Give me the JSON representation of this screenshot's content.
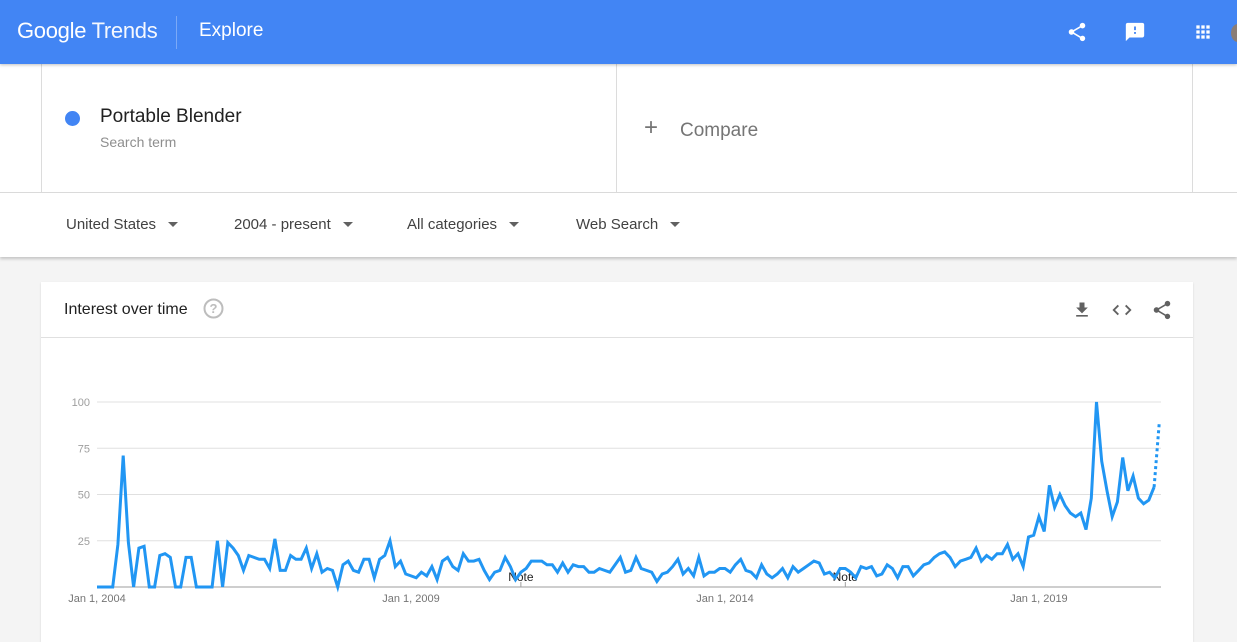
{
  "header": {
    "logo_google": "Google",
    "logo_trends": "Trends",
    "page_title": "Explore",
    "icons": [
      "share-icon",
      "feedback-icon",
      "apps-grid-icon"
    ],
    "accent_color": "#4285f4"
  },
  "search": {
    "term": "Portable Blender",
    "term_subtitle": "Search term",
    "term_color": "#4285f4",
    "compare_label": "Compare",
    "compare_icon": "plus-icon"
  },
  "filters": {
    "region": "United States",
    "time_range": "2004 - present",
    "category": "All categories",
    "property": "Web Search"
  },
  "card": {
    "title": "Interest over time",
    "help_icon": "help-circle-icon",
    "actions": [
      "download-icon",
      "embed-code-icon",
      "share-icon"
    ]
  },
  "chart_data": {
    "type": "line",
    "title": "Interest over time",
    "xlabel": "",
    "ylabel": "",
    "ylim": [
      0,
      100
    ],
    "y_ticks": [
      "25",
      "50",
      "75",
      "100"
    ],
    "y_tick_values": [
      25,
      50,
      75,
      100
    ],
    "x_tick_labels": [
      "Jan 1, 2004",
      "Jan 1, 2009",
      "Jan 1, 2014",
      "Jan 1, 2019"
    ],
    "x_tick_month_index": [
      0,
      60,
      120,
      180
    ],
    "grid": true,
    "legend": "none",
    "line_color": "#2196f3",
    "start": "2004-01",
    "interval": "month",
    "annotations": [
      {
        "label": "Note",
        "month_index": 81
      },
      {
        "label": "Note",
        "month_index": 143
      }
    ],
    "partial_last_point": true,
    "series": [
      {
        "name": "Portable Blender",
        "values": [
          0,
          0,
          0,
          0,
          23,
          71,
          24,
          0,
          21,
          22,
          0,
          0,
          17,
          18,
          16,
          0,
          0,
          16,
          16,
          0,
          0,
          0,
          0,
          25,
          0,
          24,
          21,
          17,
          9,
          17,
          16,
          15,
          15,
          10,
          26,
          9,
          9,
          17,
          15,
          15,
          21,
          10,
          18,
          8,
          10,
          9,
          0,
          12,
          14,
          9,
          8,
          15,
          15,
          5,
          15,
          17,
          25,
          11,
          14,
          7,
          6,
          5,
          8,
          6,
          11,
          4,
          14,
          16,
          11,
          9,
          18,
          14,
          14,
          15,
          9,
          4,
          8,
          9,
          16,
          11,
          4,
          8,
          10,
          14,
          14,
          14,
          12,
          12,
          8,
          13,
          8,
          12,
          11,
          11,
          8,
          8,
          10,
          9,
          8,
          12,
          16,
          8,
          9,
          16,
          10,
          9,
          8,
          3,
          7,
          8,
          11,
          15,
          7,
          10,
          6,
          16,
          6,
          8,
          8,
          10,
          10,
          8,
          12,
          15,
          9,
          8,
          5,
          12,
          7,
          5,
          7,
          10,
          5,
          11,
          8,
          10,
          12,
          14,
          13,
          7,
          8,
          5,
          10,
          10,
          8,
          5,
          11,
          10,
          11,
          6,
          7,
          12,
          10,
          5,
          11,
          11,
          6,
          9,
          12,
          13,
          16,
          18,
          19,
          16,
          11,
          14,
          15,
          16,
          21,
          14,
          17,
          15,
          18,
          18,
          23,
          15,
          18,
          11,
          27,
          28,
          38,
          30,
          55,
          43,
          50,
          44,
          40,
          38,
          40,
          31,
          48,
          100,
          68,
          52,
          38,
          46,
          70,
          52,
          60,
          48,
          45,
          47,
          54,
          89
        ]
      }
    ]
  }
}
